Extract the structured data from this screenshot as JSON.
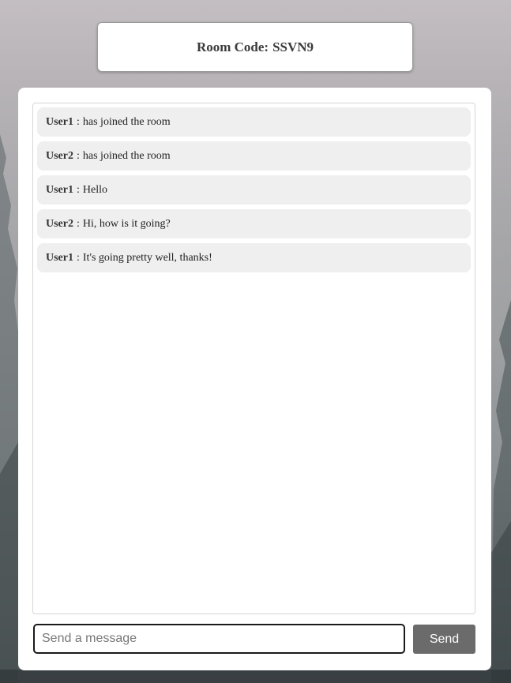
{
  "header": {
    "room_label": "Room Code:",
    "room_code": "SSVN9"
  },
  "messages": [
    {
      "user": "User1",
      "text": "has joined the room"
    },
    {
      "user": "User2",
      "text": "has joined the room"
    },
    {
      "user": "User1",
      "text": "Hello"
    },
    {
      "user": "User2",
      "text": "Hi, how is it going?"
    },
    {
      "user": "User1",
      "text": "It's going pretty well, thanks!"
    }
  ],
  "composer": {
    "placeholder": "Send a message",
    "value": "",
    "send_label": "Send"
  },
  "colors": {
    "bubble": "#efefef",
    "send_button": "#6b6b6b",
    "card": "#ffffff"
  }
}
